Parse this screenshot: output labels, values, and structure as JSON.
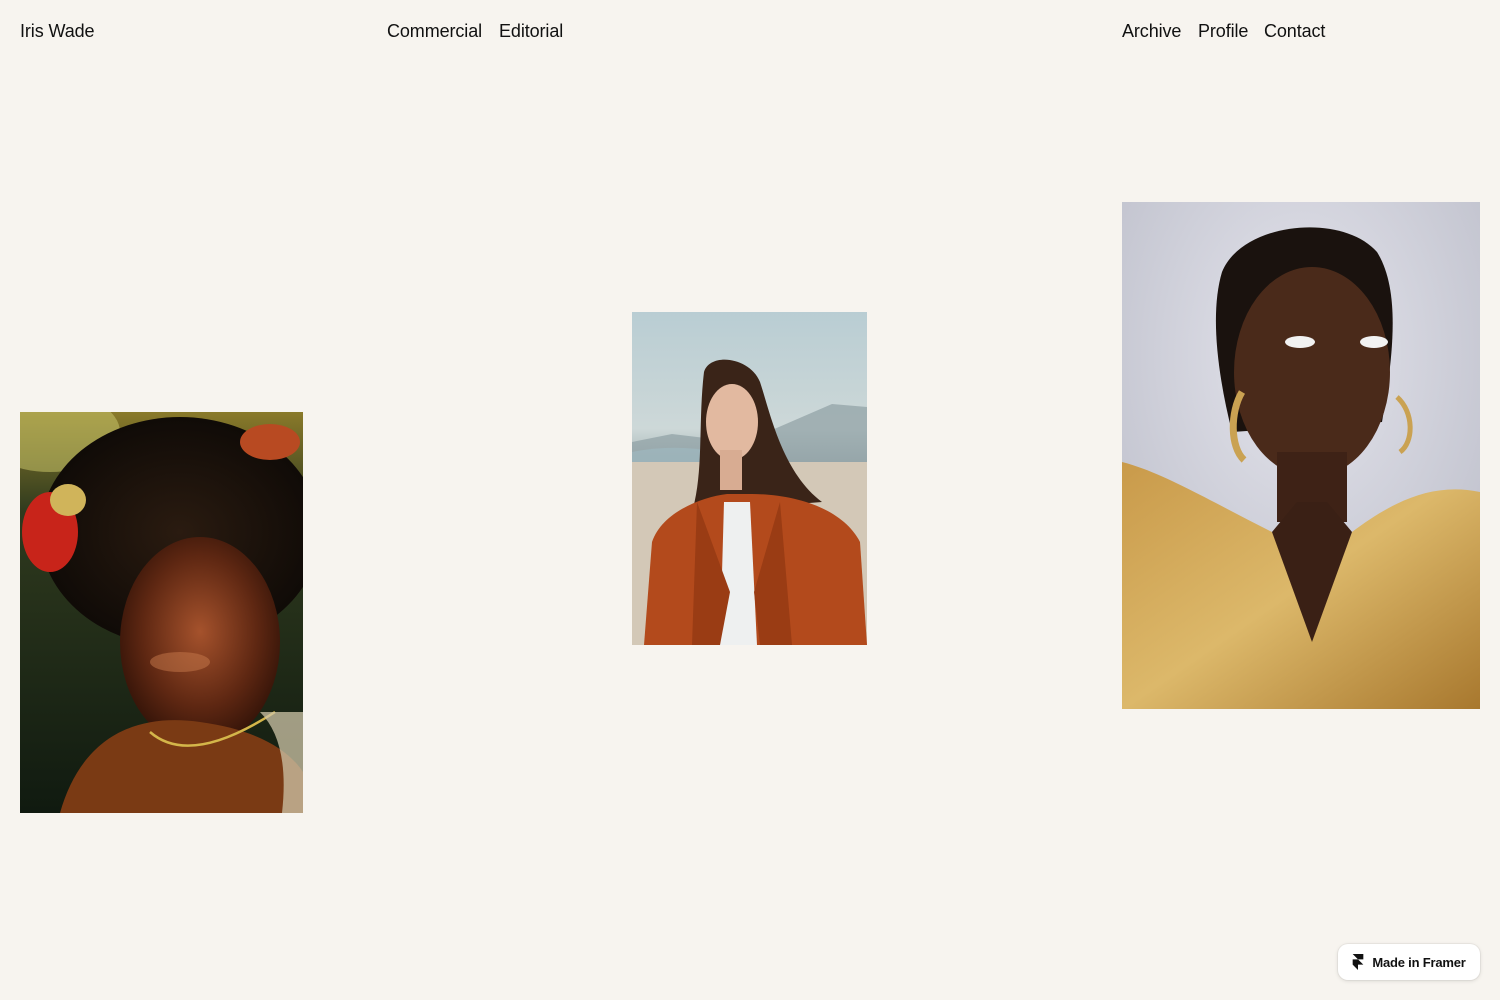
{
  "header": {
    "brand": "Iris Wade",
    "nav": {
      "commercial": "Commercial",
      "editorial": "Editorial",
      "archive": "Archive",
      "profile": "Profile",
      "contact": "Contact"
    }
  },
  "gallery": [
    {
      "subject": "portrait-afro-flowers"
    },
    {
      "subject": "portrait-orange-blazer"
    },
    {
      "subject": "portrait-gold-drape"
    }
  ],
  "badge": {
    "label": "Made in Framer",
    "icon": "framer-icon"
  },
  "colors": {
    "background": "#f7f4ef",
    "text": "#111111"
  }
}
